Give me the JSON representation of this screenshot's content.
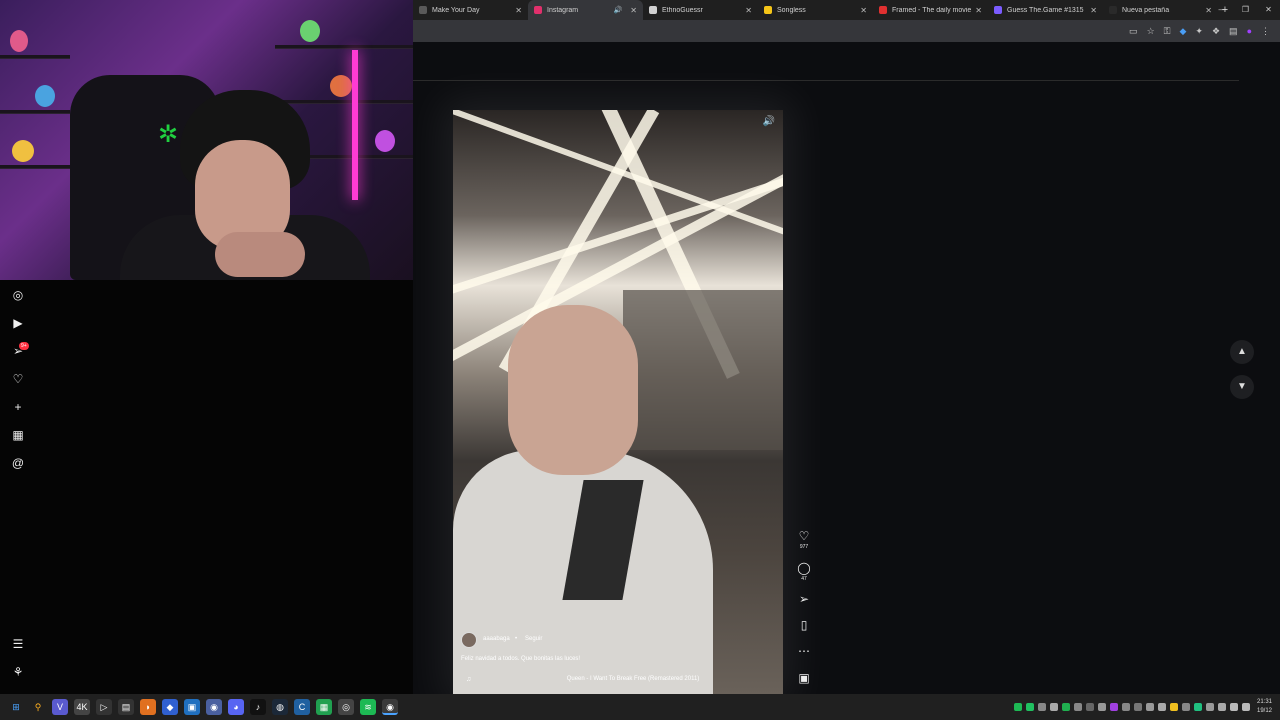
{
  "browser": {
    "tabs": [
      {
        "title": "Make Your Day",
        "active": false,
        "color": "#5a5a5a"
      },
      {
        "title": "Instagram",
        "active": true,
        "color": "#e1306c",
        "audio": true
      },
      {
        "title": "EthnoGuessr",
        "active": false,
        "color": "#d0d0d0"
      },
      {
        "title": "Songless",
        "active": false,
        "color": "#f5c518"
      },
      {
        "title": "Framed - The daily movie gu",
        "active": false,
        "color": "#e03030"
      },
      {
        "title": "Guess The.Game #1315",
        "active": false,
        "color": "#7b5cff"
      },
      {
        "title": "Nueva pestaña",
        "active": false,
        "color": "#2a2a2a"
      }
    ],
    "new_tab": "+",
    "window_controls": [
      "—",
      "❐",
      "✕"
    ],
    "toolbar_icons": [
      "cast-icon",
      "star-icon",
      "key-icon",
      "shield-icon",
      "extensions-icon",
      "bookmark-icon",
      "profile-icon",
      "menu-icon"
    ]
  },
  "reel": {
    "username": "aaaabaga",
    "separator": "•",
    "follow_label": "Seguir",
    "caption": "Feliz navidad a todos. Que bonitas las luces!",
    "music_note": "♫",
    "song": "Queen - I Want To Break Free (Remastered 2011)",
    "likes": "977",
    "comments": "47"
  },
  "nav": {
    "badge": "9+"
  },
  "taskbar": {
    "clock_time": "21:31",
    "clock_date": "19/12"
  }
}
